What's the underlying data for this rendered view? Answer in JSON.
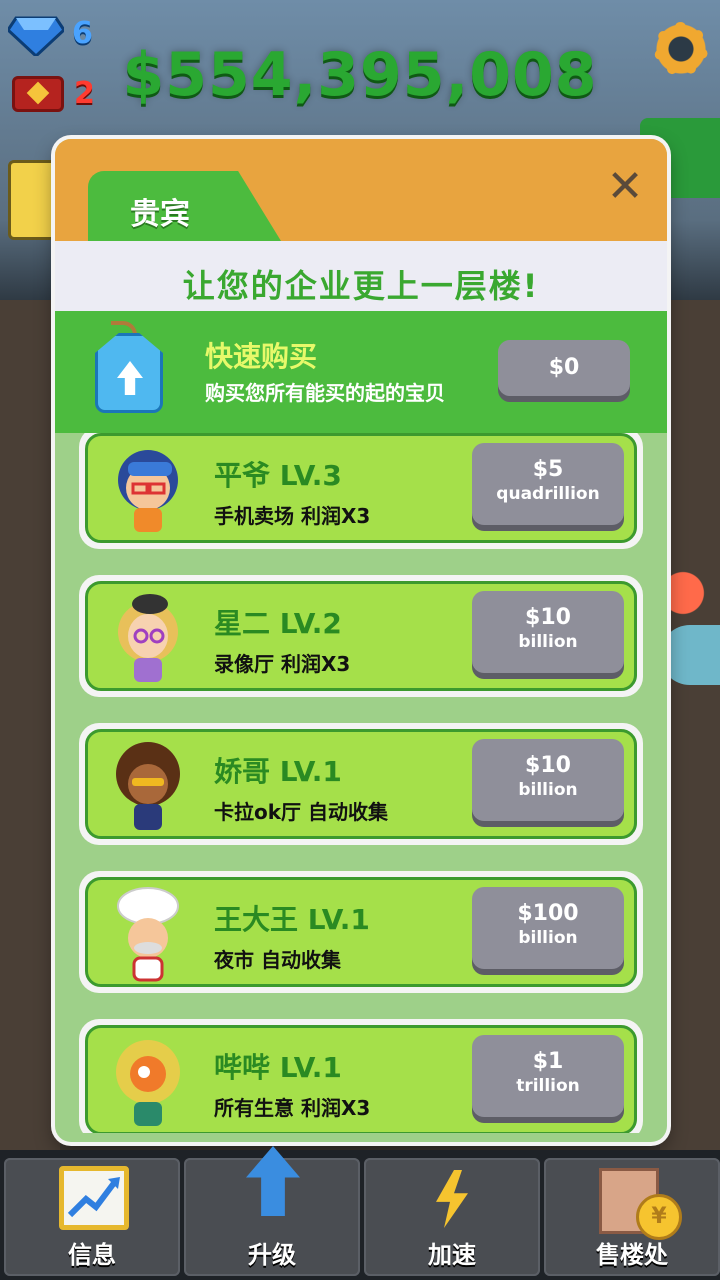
{
  "hud": {
    "gem_count": "6",
    "ticket_count": "2",
    "money": "$554,395,008"
  },
  "dialog": {
    "tab_label": "贵宾",
    "close_label": "✕",
    "subtitle": "让您的企业更上一层楼!",
    "quick_buy": {
      "title": "快速购买",
      "description": "购买您所有能买的起的宝贝",
      "price": "$0"
    },
    "managers": [
      {
        "name": "平爷 LV.3",
        "description": "手机卖场 利润X3",
        "price_value": "$5",
        "price_unit": "quadrillion"
      },
      {
        "name": "星二 LV.2",
        "description": "录像厅 利润X3",
        "price_value": "$10",
        "price_unit": "billion"
      },
      {
        "name": "娇哥 LV.1",
        "description": "卡拉ok厅 自动收集",
        "price_value": "$10",
        "price_unit": "billion"
      },
      {
        "name": "王大王 LV.1",
        "description": "夜市 自动收集",
        "price_value": "$100",
        "price_unit": "billion"
      },
      {
        "name": "哔哔 LV.1",
        "description": "所有生意 利润X3",
        "price_value": "$1",
        "price_unit": "trillion"
      }
    ]
  },
  "nav": {
    "items": [
      {
        "label": "信息",
        "icon": "chart-icon"
      },
      {
        "label": "升级",
        "icon": "arrow-up-icon"
      },
      {
        "label": "加速",
        "icon": "lightning-icon"
      },
      {
        "label": "售楼处",
        "icon": "building-coin-icon"
      }
    ]
  },
  "colors": {
    "accent_green": "#4cbb3e",
    "header_orange": "#e8a43f",
    "card_green": "#a5e04a",
    "button_gray": "#8f8f9a"
  }
}
